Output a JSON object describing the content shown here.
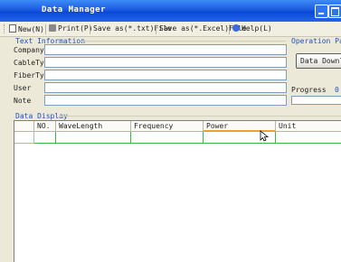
{
  "window": {
    "title": "Data Manager"
  },
  "menu": {
    "new": "New(N)",
    "print": "Print(P)",
    "save_txt": "Save as(*.txt)File",
    "save_excel": "Save as(*.Excel)File",
    "help": "Help(L)"
  },
  "text_info": {
    "group_label": "Text Information",
    "fields": [
      {
        "label": "Company",
        "value": ""
      },
      {
        "label": "CableType",
        "value": ""
      },
      {
        "label": "FiberType",
        "value": ""
      },
      {
        "label": "User",
        "value": ""
      },
      {
        "label": "Note",
        "value": ""
      }
    ]
  },
  "operation": {
    "group_label": "Operation Panel",
    "download_button": "Data Download",
    "progress_label": "Progress",
    "progress_value": "0"
  },
  "data_display": {
    "group_label": "Data Display",
    "columns": [
      "NO.",
      "WaveLength",
      "Frequency",
      "Power",
      "Unit"
    ],
    "row_indicator": "✱",
    "rows": [
      [
        "",
        "",
        "",
        "",
        ""
      ]
    ]
  },
  "colors": {
    "title_bar": "#0a48d8",
    "group_label": "#2050c8",
    "grid_line": "#3cb44a"
  }
}
